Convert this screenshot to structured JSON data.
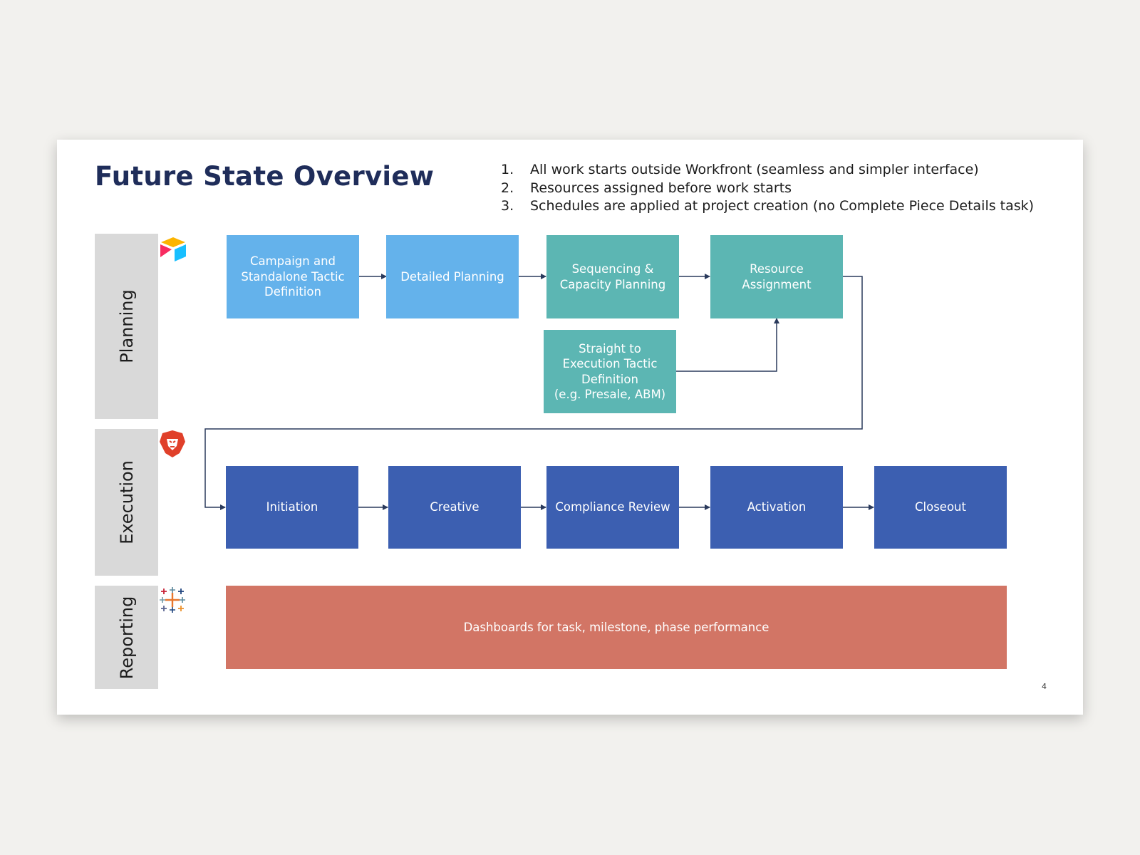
{
  "slide": {
    "title": "Future State Overview",
    "notes": [
      {
        "num": "1.",
        "text": "All work starts outside Workfront (seamless and simpler interface)"
      },
      {
        "num": "2.",
        "text": "Resources assigned before work starts"
      },
      {
        "num": "3.",
        "text": "Schedules are applied at project creation (no Complete Piece Details task)"
      }
    ],
    "lanes": {
      "planning": "Planning",
      "execution": "Execution",
      "reporting": "Reporting"
    },
    "planning_steps": {
      "campaign": "Campaign and\nStandalone Tactic\nDefinition",
      "detailed": "Detailed Planning",
      "sequencing": "Sequencing &\nCapacity Planning",
      "resource": "Resource\nAssignment",
      "straight": "Straight to\nExecution Tactic\nDefinition\n(e.g. Presale, ABM)"
    },
    "execution_steps": {
      "initiation": "Initiation",
      "creative": "Creative",
      "compliance": "Compliance Review",
      "activation": "Activation",
      "closeout": "Closeout"
    },
    "reporting": {
      "dashboards": "Dashboards for task, milestone, phase performance"
    },
    "icons": {
      "planning": "airtable-logo-icon",
      "execution": "lion-shield-logo-icon",
      "reporting": "tableau-plus-logo-icon"
    },
    "colors": {
      "title": "#1f2d5a",
      "light_blue": "#64b2eb",
      "teal": "#5cb6b3",
      "dark_blue": "#3c5fb1",
      "reporting": "#d27565",
      "connector": "#2a3a5c",
      "lane": "#d9d9d9"
    },
    "page_number": "4"
  }
}
